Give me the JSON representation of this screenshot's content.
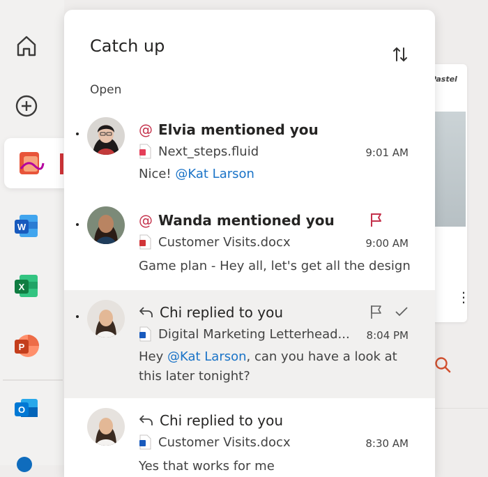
{
  "panel": {
    "title": "Catch up",
    "section_label": "Open"
  },
  "items": [
    {
      "heading": "Elvia mentioned you",
      "icon": "at-icon",
      "file": "Next_steps.fluid",
      "time": "9:01 AM",
      "preview_prefix": "Nice! ",
      "preview_mention": "@Kat Larson",
      "preview_suffix": ""
    },
    {
      "heading": "Wanda mentioned you",
      "icon": "at-icon",
      "file": "Customer Visits.docx",
      "time": "9:00 AM",
      "preview_prefix": "Game plan - Hey all, let's get all the design",
      "flagged": true
    },
    {
      "heading": "Chi replied to you",
      "icon": "reply-icon",
      "file": "Digital Marketing Letterhead...",
      "time": "8:04 PM",
      "preview_prefix": "Hey ",
      "preview_mention": "@Kat Larson",
      "preview_suffix": ", can you have a look at this later tonight?"
    },
    {
      "heading": "Chi replied to you",
      "icon": "reply-icon",
      "file": "Customer Visits.docx",
      "time": "8:30 AM",
      "preview_prefix": "Yes that works for me"
    }
  ],
  "colors": {
    "mention": "#1a73c7",
    "accent_red": "#c4314b",
    "selected_bg": "#f1f0ef"
  },
  "background": {
    "card_title": "Pastel"
  }
}
